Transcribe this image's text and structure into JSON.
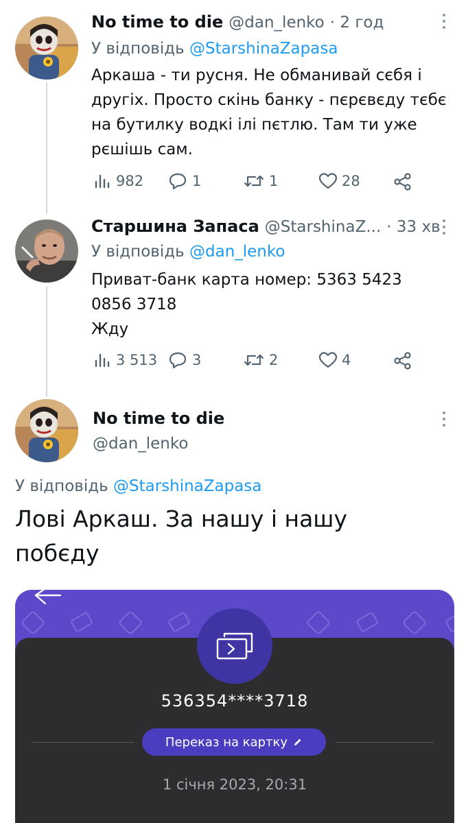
{
  "tweet1": {
    "name": "No time to die",
    "handle": "@dan_lenko",
    "time": "· 2 год",
    "reply_prefix": "У відповідь",
    "reply_mention": "@StarshinaZapasa",
    "lines": [
      "Аркаша - ти русня. Не обманивай сєбя і",
      "другіх. Просто скінь банку - пєрєвєду тєбє",
      "на бутилку водкі ілі пєтлю. Там ти уже",
      "рєшішь сам."
    ],
    "views": "982",
    "replies": "1",
    "retweets": "1",
    "likes": "28"
  },
  "tweet2": {
    "name": "Старшина Запаса",
    "handle": "@StarshinaZ...",
    "time": "· 33 хв",
    "reply_prefix": "У відповідь",
    "reply_mention": "@dan_lenko",
    "lines": [
      "Приват-банк карта номер: 5363 5423",
      "0856 3718",
      "Жду"
    ],
    "views": "3 513",
    "replies": "3",
    "retweets": "2",
    "likes": "4"
  },
  "tweet3": {
    "name": "No time to die",
    "handle": "@dan_lenko",
    "reply_prefix": "У відповідь",
    "reply_mention": "@StarshinaZapasa",
    "lines": [
      "Лові Аркаш. За нашу і нашу",
      "побєду"
    ]
  },
  "card": {
    "number": "536354****3718",
    "pill_label": "Переказ на картку",
    "date": "1 січня 2023, 20:31"
  },
  "colors": {
    "link": "#1d9bf0",
    "card_purple": "#5b49c9",
    "card_dark": "#2d2d30"
  }
}
